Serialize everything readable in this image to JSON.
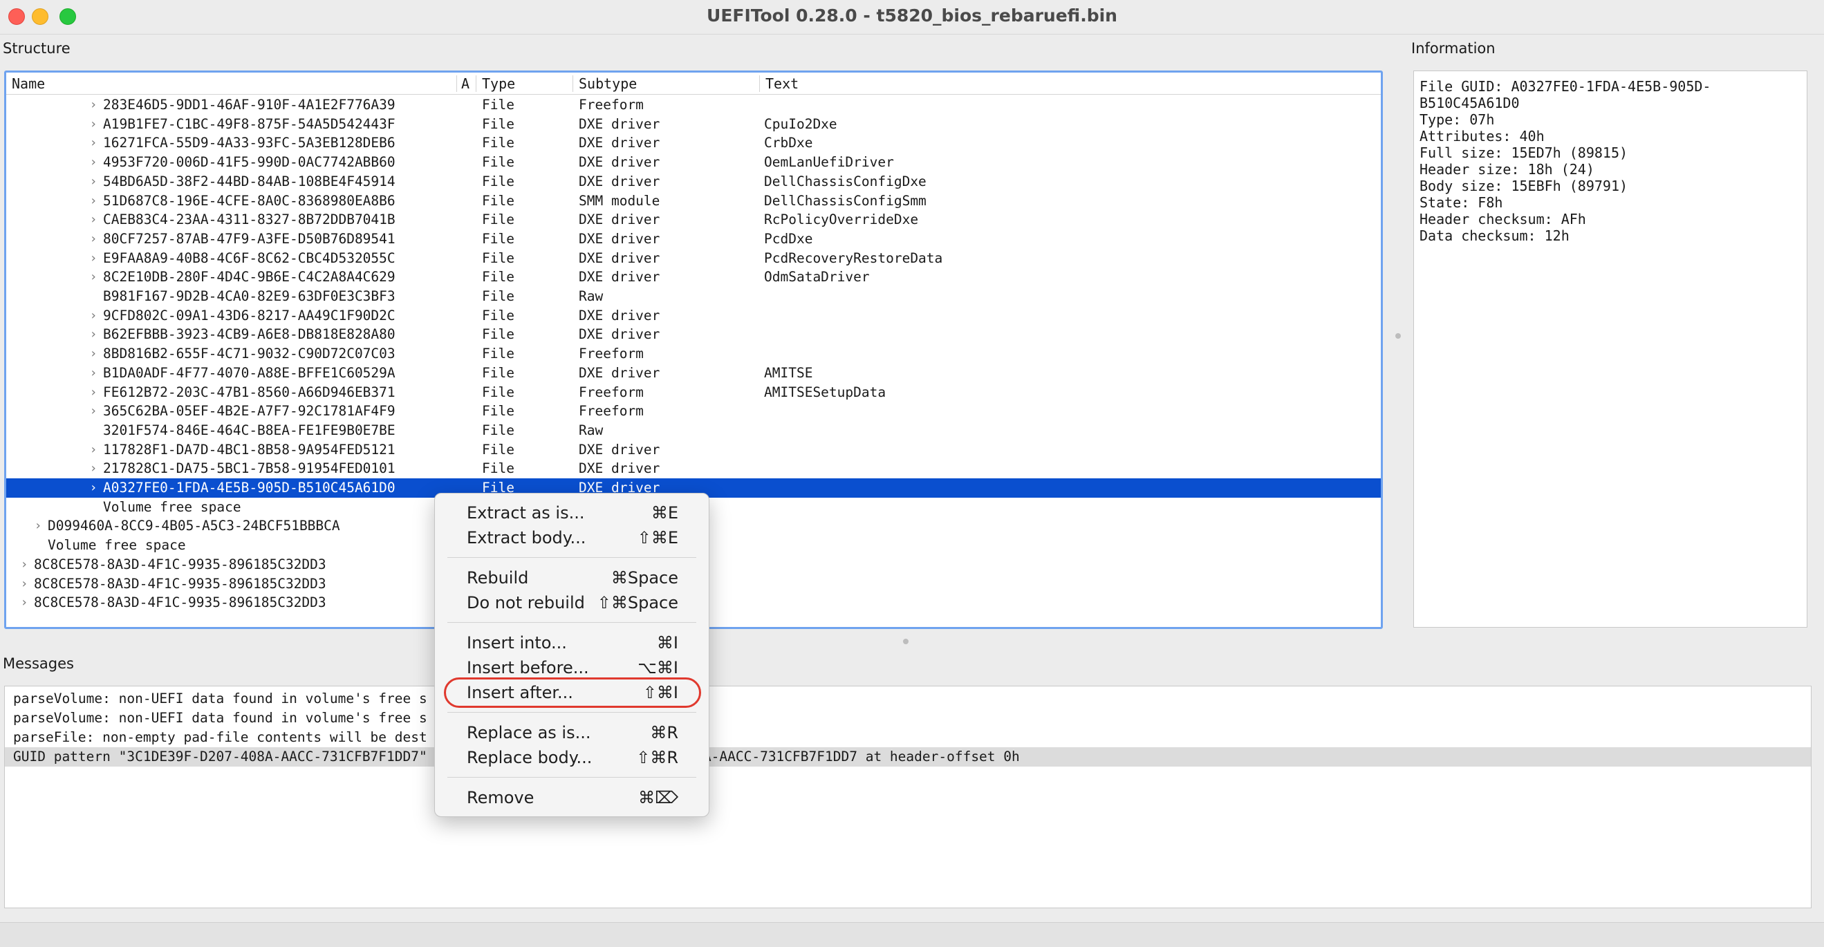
{
  "window": {
    "title": "UEFITool 0.28.0 - t5820_bios_rebaruefi.bin"
  },
  "labels": {
    "structure": "Structure",
    "information": "Information",
    "messages": "Messages"
  },
  "tree": {
    "columns": {
      "name": "Name",
      "a": "A",
      "type": "Type",
      "subtype": "Subtype",
      "text": "Text"
    },
    "rows": [
      {
        "name": "283E46D5-9DD1-46AF-910F-4A1E2F776A39",
        "type": "File",
        "subtype": "Freeform",
        "text": ""
      },
      {
        "name": "A19B1FE7-C1BC-49F8-875F-54A5D542443F",
        "type": "File",
        "subtype": "DXE driver",
        "text": "CpuIo2Dxe"
      },
      {
        "name": "16271FCA-55D9-4A33-93FC-5A3EB128DEB6",
        "type": "File",
        "subtype": "DXE driver",
        "text": "CrbDxe"
      },
      {
        "name": "4953F720-006D-41F5-990D-0AC7742ABB60",
        "type": "File",
        "subtype": "DXE driver",
        "text": "OemLanUefiDriver"
      },
      {
        "name": "54BD6A5D-38F2-44BD-84AB-108BE4F45914",
        "type": "File",
        "subtype": "DXE driver",
        "text": "DellChassisConfigDxe"
      },
      {
        "name": "51D687C8-196E-4CFE-8A0C-8368980EA8B6",
        "type": "File",
        "subtype": "SMM module",
        "text": "DellChassisConfigSmm"
      },
      {
        "name": "CAEB83C4-23AA-4311-8327-8B72DDB7041B",
        "type": "File",
        "subtype": "DXE driver",
        "text": "RcPolicyOverrideDxe"
      },
      {
        "name": "80CF7257-87AB-47F9-A3FE-D50B76D89541",
        "type": "File",
        "subtype": "DXE driver",
        "text": "PcdDxe"
      },
      {
        "name": "E9FAA8A9-40B8-4C6F-8C62-CBC4D532055C",
        "type": "File",
        "subtype": "DXE driver",
        "text": "PcdRecoveryRestoreData"
      },
      {
        "name": "8C2E10DB-280F-4D4C-9B6E-C4C2A8A4C629",
        "type": "File",
        "subtype": "DXE driver",
        "text": "OdmSataDriver"
      },
      {
        "name": "B981F167-9D2B-4CA0-82E9-63DF0E3C3BF3",
        "type": "File",
        "subtype": "Raw",
        "text": ""
      },
      {
        "name": "9CFD802C-09A1-43D6-8217-AA49C1F90D2C",
        "type": "File",
        "subtype": "DXE driver",
        "text": ""
      },
      {
        "name": "B62EFBBB-3923-4CB9-A6E8-DB818E828A80",
        "type": "File",
        "subtype": "DXE driver",
        "text": ""
      },
      {
        "name": "8BD816B2-655F-4C71-9032-C90D72C07C03",
        "type": "File",
        "subtype": "Freeform",
        "text": ""
      },
      {
        "name": "B1DA0ADF-4F77-4070-A88E-BFFE1C60529A",
        "type": "File",
        "subtype": "DXE driver",
        "text": "AMITSE"
      },
      {
        "name": "FE612B72-203C-47B1-8560-A66D946EB371",
        "type": "File",
        "subtype": "Freeform",
        "text": "AMITSESetupData"
      },
      {
        "name": "365C62BA-05EF-4B2E-A7F7-92C1781AF4F9",
        "type": "File",
        "subtype": "Freeform",
        "text": ""
      },
      {
        "name": "3201F574-846E-464C-B8EA-FE1FE9B0E7BE",
        "type": "File",
        "subtype": "Raw",
        "text": ""
      },
      {
        "name": "117828F1-DA7D-4BC1-8B58-9A954FED5121",
        "type": "File",
        "subtype": "DXE driver",
        "text": ""
      },
      {
        "name": "217828C1-DA75-5BC1-7B58-91954FED0101",
        "type": "File",
        "subtype": "DXE driver",
        "text": ""
      },
      {
        "name": "A0327FE0-1FDA-4E5B-905D-B510C45A61D0",
        "type": "File",
        "subtype": "DXE driver",
        "text": ""
      },
      {
        "name": "Volume free space",
        "type": "",
        "subtype": "",
        "text": ""
      },
      {
        "name": "D099460A-8CC9-4B05-A5C3-24BCF51BBBCA",
        "type": "",
        "subtype": "",
        "text": ""
      },
      {
        "name": "Volume free space",
        "type": "",
        "subtype": "",
        "text": ""
      },
      {
        "name": "8C8CE578-8A3D-4F1C-9935-896185C32DD3",
        "type": "",
        "subtype": "",
        "text": ""
      },
      {
        "name": "8C8CE578-8A3D-4F1C-9935-896185C32DD3",
        "type": "",
        "subtype": "",
        "text": ""
      },
      {
        "name": "8C8CE578-8A3D-4F1C-9935-896185C32DD3",
        "type": "",
        "subtype": "",
        "text": ""
      }
    ]
  },
  "info": {
    "lines": [
      "File GUID: A0327FE0-1FDA-4E5B-905D-",
      "B510C45A61D0",
      "Type: 07h",
      "Attributes: 40h",
      "Full size: 15ED7h (89815)",
      "Header size: 18h (24)",
      "Body size: 15EBFh (89791)",
      "State: F8h",
      "Header checksum: AFh",
      "Data checksum: 12h"
    ]
  },
  "messages": [
    "parseVolume: non-UEFI data found in volume's free s",
    "parseVolume: non-UEFI data found in volume's free s",
    "parseFile: non-empty pad-file contents will be dest",
    "GUID pattern \"3C1DE39F-D207-408A-AACC-731CFB7F1DD7\"                                     31CFB7F1DD7\" in 3C1DE39F-D207-408A-AACC-731CFB7F1DD7 at header-offset 0h"
  ],
  "context_menu": {
    "items": [
      {
        "label": "Extract as is...",
        "shortcut": "⌘E"
      },
      {
        "label": "Extract body...",
        "shortcut": "⇧⌘E"
      },
      {
        "label": "Rebuild",
        "shortcut": "⌘Space"
      },
      {
        "label": "Do not rebuild",
        "shortcut": "⇧⌘Space"
      },
      {
        "label": "Insert into...",
        "shortcut": "⌘I"
      },
      {
        "label": "Insert before...",
        "shortcut": "⌥⌘I"
      },
      {
        "label": "Insert after...",
        "shortcut": "⇧⌘I"
      },
      {
        "label": "Replace as is...",
        "shortcut": "⌘R"
      },
      {
        "label": "Replace body...",
        "shortcut": "⇧⌘R"
      },
      {
        "label": "Remove",
        "shortcut": "⌘⌦"
      }
    ]
  },
  "colors": {
    "selection": "#0a4fcf",
    "highlight_ring": "#e0392e",
    "focus_border": "#6fa3ef"
  }
}
